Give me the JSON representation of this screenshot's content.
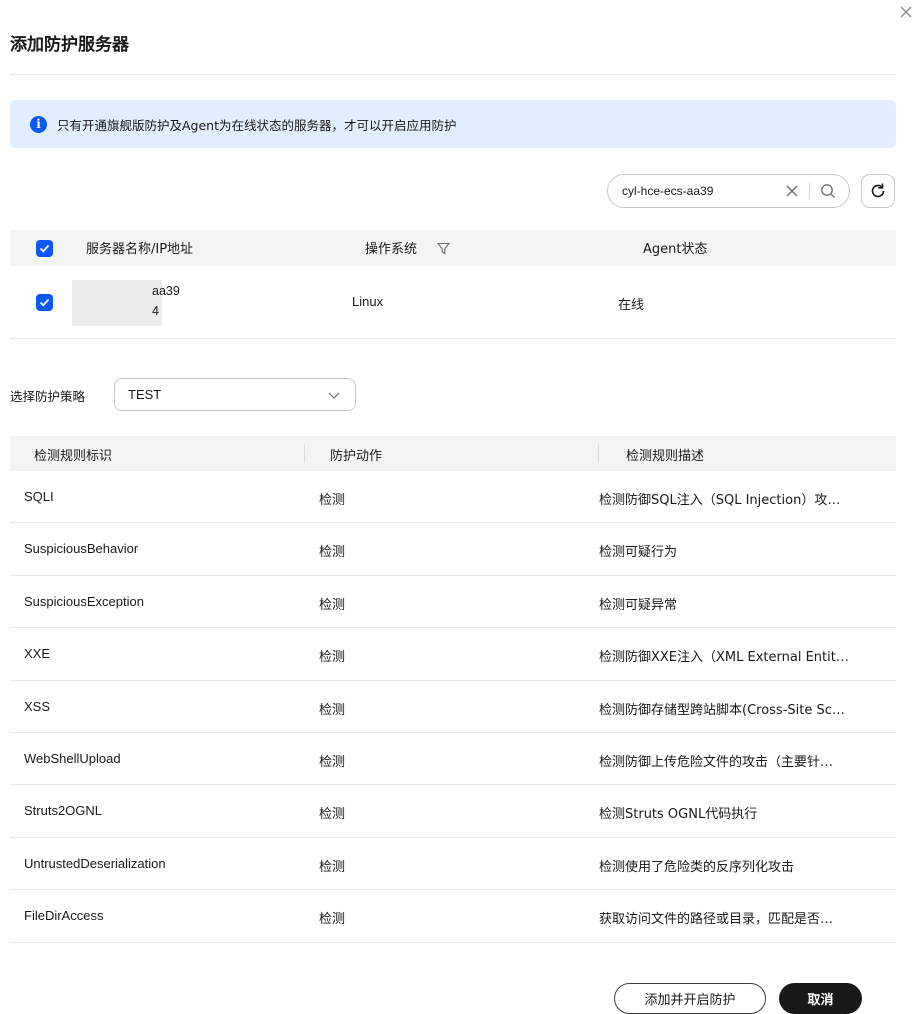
{
  "dialog": {
    "title": "添加防护服务器",
    "info_text": "只有开通旗舰版防护及Agent为在线状态的服务器，才可以开启应用防护"
  },
  "search": {
    "value": "cyl-hce-ecs-aa39"
  },
  "server_table": {
    "headers": [
      "服务器名称/IP地址",
      "操作系统",
      "Agent状态"
    ],
    "rows": [
      {
        "name_suffix": "aa39",
        "ip_suffix": "4",
        "os": "Linux",
        "agent_status": "在线"
      }
    ]
  },
  "policy": {
    "label": "选择防护策略",
    "selected": "TEST"
  },
  "rules_table": {
    "headers": [
      "检测规则标识",
      "防护动作",
      "检测规则描述"
    ],
    "rows": [
      {
        "id": "SQLI",
        "action": "检测",
        "desc": "检测防御SQL注入（SQL Injection）攻…"
      },
      {
        "id": "SuspiciousBehavior",
        "action": "检测",
        "desc": "检测可疑行为"
      },
      {
        "id": "SuspiciousException",
        "action": "检测",
        "desc": "检测可疑异常"
      },
      {
        "id": "XXE",
        "action": "检测",
        "desc": "检测防御XXE注入（XML External Entit…"
      },
      {
        "id": "XSS",
        "action": "检测",
        "desc": "检测防御存储型跨站脚本(Cross-Site Sc…"
      },
      {
        "id": "WebShellUpload",
        "action": "检测",
        "desc": "检测防御上传危险文件的攻击（主要针…"
      },
      {
        "id": "Struts2OGNL",
        "action": "检测",
        "desc": "检测Struts OGNL代码执行"
      },
      {
        "id": "UntrustedDeserialization",
        "action": "检测",
        "desc": "检测使用了危险类的反序列化攻击"
      },
      {
        "id": "FileDirAccess",
        "action": "检测",
        "desc": "获取访问文件的路径或目录，匹配是否…"
      }
    ]
  },
  "footer": {
    "confirm_label": "添加并开启防护",
    "cancel_label": "取消"
  },
  "colors": {
    "accent": "#0a59f7",
    "alert_bg": "#e1eefe",
    "dark_button": "#191919"
  }
}
